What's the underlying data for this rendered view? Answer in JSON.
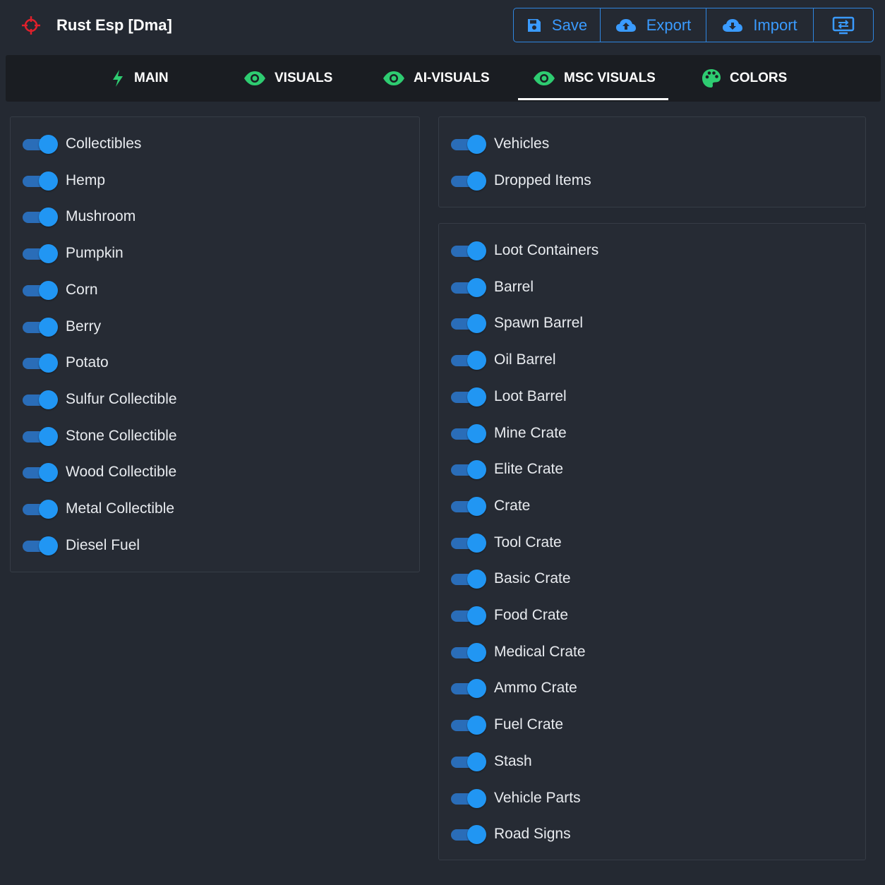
{
  "app": {
    "title": "Rust Esp [Dma]",
    "icon": "crosshair-icon",
    "icon_color": "#e0202b"
  },
  "toolbar": {
    "accent_color": "#3a9bff",
    "save_label": "Save",
    "export_label": "Export",
    "import_label": "Import",
    "save_icon": "floppy-disk-icon",
    "export_icon": "cloud-upload-icon",
    "import_icon": "cloud-download-icon",
    "extra_icon": "monitor-sync-icon"
  },
  "tabs": [
    {
      "label": "MAIN",
      "icon": "lightning-icon",
      "active": false
    },
    {
      "label": "VISUALS",
      "icon": "eye-icon",
      "active": false
    },
    {
      "label": "AI-VISUALS",
      "icon": "eye-icon",
      "active": false
    },
    {
      "label": "MSC VISUALS",
      "icon": "eye-icon",
      "active": true
    },
    {
      "label": "COLORS",
      "icon": "palette-icon",
      "active": false
    }
  ],
  "tab_icon_color": "#2ecc71",
  "toggle_color": "#2196f3",
  "left_panel": {
    "items": [
      {
        "label": "Collectibles",
        "enabled": true
      },
      {
        "label": "Hemp",
        "enabled": true
      },
      {
        "label": "Mushroom",
        "enabled": true
      },
      {
        "label": "Pumpkin",
        "enabled": true
      },
      {
        "label": "Corn",
        "enabled": true
      },
      {
        "label": "Berry",
        "enabled": true
      },
      {
        "label": "Potato",
        "enabled": true
      },
      {
        "label": "Sulfur Collectible",
        "enabled": true
      },
      {
        "label": "Stone Collectible",
        "enabled": true
      },
      {
        "label": "Wood Collectible",
        "enabled": true
      },
      {
        "label": "Metal Collectible",
        "enabled": true
      },
      {
        "label": "Diesel Fuel",
        "enabled": true
      }
    ]
  },
  "right_top_panel": {
    "items": [
      {
        "label": "Vehicles",
        "enabled": true
      },
      {
        "label": "Dropped Items",
        "enabled": true
      }
    ]
  },
  "right_bottom_panel": {
    "items": [
      {
        "label": "Loot Containers",
        "enabled": true
      },
      {
        "label": "Barrel",
        "enabled": true
      },
      {
        "label": "Spawn Barrel",
        "enabled": true
      },
      {
        "label": "Oil Barrel",
        "enabled": true
      },
      {
        "label": "Loot Barrel",
        "enabled": true
      },
      {
        "label": "Mine Crate",
        "enabled": true
      },
      {
        "label": "Elite Crate",
        "enabled": true
      },
      {
        "label": "Crate",
        "enabled": true
      },
      {
        "label": "Tool Crate",
        "enabled": true
      },
      {
        "label": "Basic Crate",
        "enabled": true
      },
      {
        "label": "Food Crate",
        "enabled": true
      },
      {
        "label": "Medical Crate",
        "enabled": true
      },
      {
        "label": "Ammo Crate",
        "enabled": true
      },
      {
        "label": "Fuel Crate",
        "enabled": true
      },
      {
        "label": "Stash",
        "enabled": true
      },
      {
        "label": "Vehicle Parts",
        "enabled": true
      },
      {
        "label": "Road Signs",
        "enabled": true
      }
    ]
  }
}
